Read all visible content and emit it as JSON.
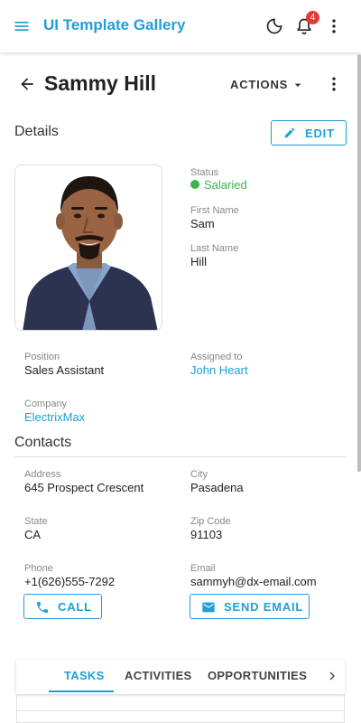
{
  "app": {
    "title": "UI Template Gallery",
    "notification_count": "4"
  },
  "header": {
    "name": "Sammy Hill",
    "actions_label": "ACTIONS"
  },
  "details": {
    "section_title": "Details",
    "edit_label": "EDIT",
    "status_label": "Status",
    "status_value": "Salaried",
    "first_name_label": "First Name",
    "first_name": "Sam",
    "last_name_label": "Last Name",
    "last_name": "Hill",
    "position_label": "Position",
    "position": "Sales Assistant",
    "assigned_label": "Assigned to",
    "assigned": "John Heart",
    "company_label": "Company",
    "company": "ElectrixMax"
  },
  "contacts": {
    "section_title": "Contacts",
    "address_label": "Address",
    "address": "645 Prospect Crescent",
    "city_label": "City",
    "city": "Pasadena",
    "state_label": "State",
    "state": "CA",
    "zip_label": "Zip Code",
    "zip": "91103",
    "phone_label": "Phone",
    "phone": "+1(626)555-7292",
    "email_label": "Email",
    "email": "sammyh@dx-email.com",
    "call_label": "CALL",
    "send_email_label": "SEND EMAIL"
  },
  "tabs": {
    "items": [
      "TASKS",
      "ACTIVITIES",
      "OPPORTUNITIES"
    ],
    "active": "TASKS"
  },
  "colors": {
    "accent": "#1e9fd9",
    "status_green": "#3cb44b",
    "badge": "#e53935"
  },
  "icons": [
    "menu-icon",
    "moon-icon",
    "bell-icon",
    "more-vert-icon",
    "back-arrow-icon",
    "caret-down-icon",
    "pencil-icon",
    "phone-icon",
    "mail-icon",
    "chevron-right-icon"
  ]
}
